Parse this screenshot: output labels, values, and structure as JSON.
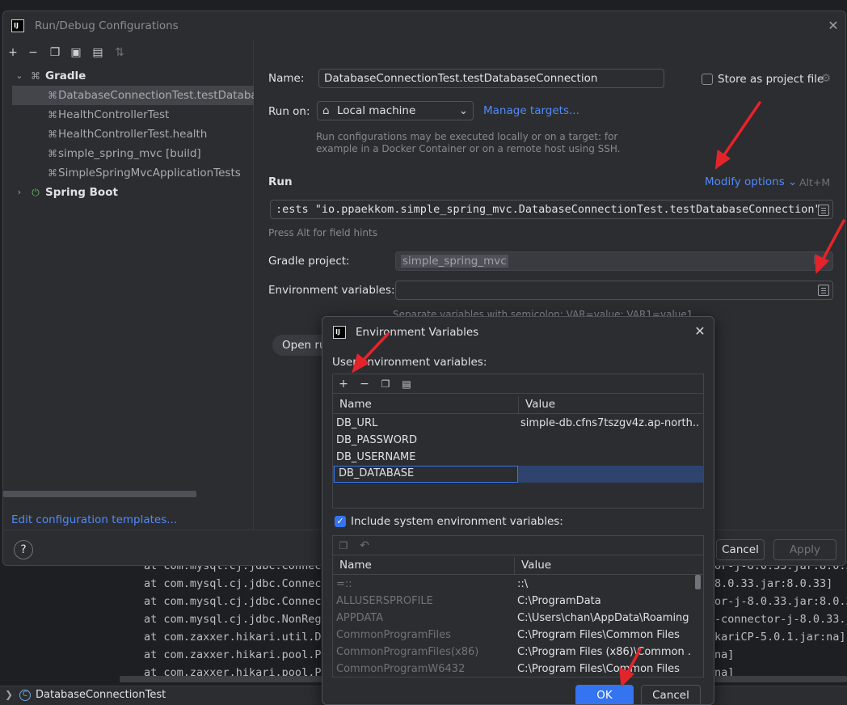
{
  "background": {
    "console_lines": [
      "at com.mysql.cj.jdbc.Connect",
      "at com.mysql.cj.jdbc.Connect",
      "at com.mysql.cj.jdbc.Connect",
      "at com.mysql.cj.jdbc.NonRegi",
      "at com.zaxxer.hikari.util.Dr",
      "at com.zaxxer.hikari.pool.Po",
      "at com.zaxxer.hikari.pool.Po"
    ],
    "console_right": [
      "or-j-8.0.33.jar:8.0.3",
      "8.0.33.jar:8.0.33]",
      "or-j-8.0.33.jar:8.0.3",
      "-connector-j-8.0.33.j",
      "kariCP-5.0.1.jar:na]",
      "na]",
      "na]"
    ],
    "status_text": "DatabaseConnectionTest"
  },
  "run_dialog": {
    "title": "Run/Debug Configurations",
    "tree": {
      "gradle_label": "Gradle",
      "items": [
        "DatabaseConnectionTest.testDatabaseConnection",
        "HealthControllerTest",
        "HealthControllerTest.health",
        "simple_spring_mvc [build]",
        "SimpleSpringMvcApplicationTests"
      ],
      "spring_boot_label": "Spring Boot"
    },
    "edit_templates": "Edit configuration templates...",
    "name_label": "Name:",
    "name_value": "DatabaseConnectionTest.testDatabaseConnection",
    "store_label": "Store as project file",
    "run_on_label": "Run on:",
    "run_on_value": "Local machine",
    "manage_targets": "Manage targets...",
    "run_on_hint_1": "Run configurations may be executed locally or on a target: for",
    "run_on_hint_2": "example in a Docker Container or on a remote host using SSH.",
    "run_section": "Run",
    "modify_options": "Modify options",
    "modify_shortcut": "Alt+M",
    "run_command": ":ests \"io.ppaekkom.simple_spring_mvc.DatabaseConnectionTest.testDatabaseConnection\"",
    "alt_hint": "Press Alt for field hints",
    "gradle_project_label": "Gradle project:",
    "gradle_project_value": "simple_spring_mvc",
    "env_label": "Environment variables:",
    "env_value": "",
    "env_hint": "Separate variables with semicolon: VAR=value; VAR1=value1",
    "open_run_label": "Open run",
    "cancel_label": "Cancel",
    "apply_label": "Apply",
    "help_label": "?"
  },
  "env_dialog": {
    "title": "Environment Variables",
    "user_section_label": "User environment variables:",
    "columns": [
      "Name",
      "Value"
    ],
    "user_vars": [
      {
        "name": "DB_URL",
        "value": "simple-db.cfns7tszgv4z.ap-north..."
      },
      {
        "name": "DB_PASSWORD",
        "value": ""
      },
      {
        "name": "DB_USERNAME",
        "value": ""
      },
      {
        "name": "DB_DATABASE",
        "value": ""
      }
    ],
    "include_system_label": "Include system environment variables:",
    "include_system_checked": true,
    "system_vars": [
      {
        "name": "=::",
        "value": "::\\"
      },
      {
        "name": "ALLUSERSPROFILE",
        "value": "C:\\ProgramData"
      },
      {
        "name": "APPDATA",
        "value": "C:\\Users\\chan\\AppData\\Roaming"
      },
      {
        "name": "CommonProgramFiles",
        "value": "C:\\Program Files\\Common Files"
      },
      {
        "name": "CommonProgramFiles(x86)",
        "value": "C:\\Program Files (x86)\\Common ..."
      },
      {
        "name": "CommonProgramW6432",
        "value": "C:\\Program Files\\Common Files"
      }
    ],
    "ok_label": "OK",
    "cancel_label": "Cancel"
  },
  "colors": {
    "accent": "#3574f0",
    "annotation_arrow": "#e3242b",
    "selection": "#2e436e"
  }
}
